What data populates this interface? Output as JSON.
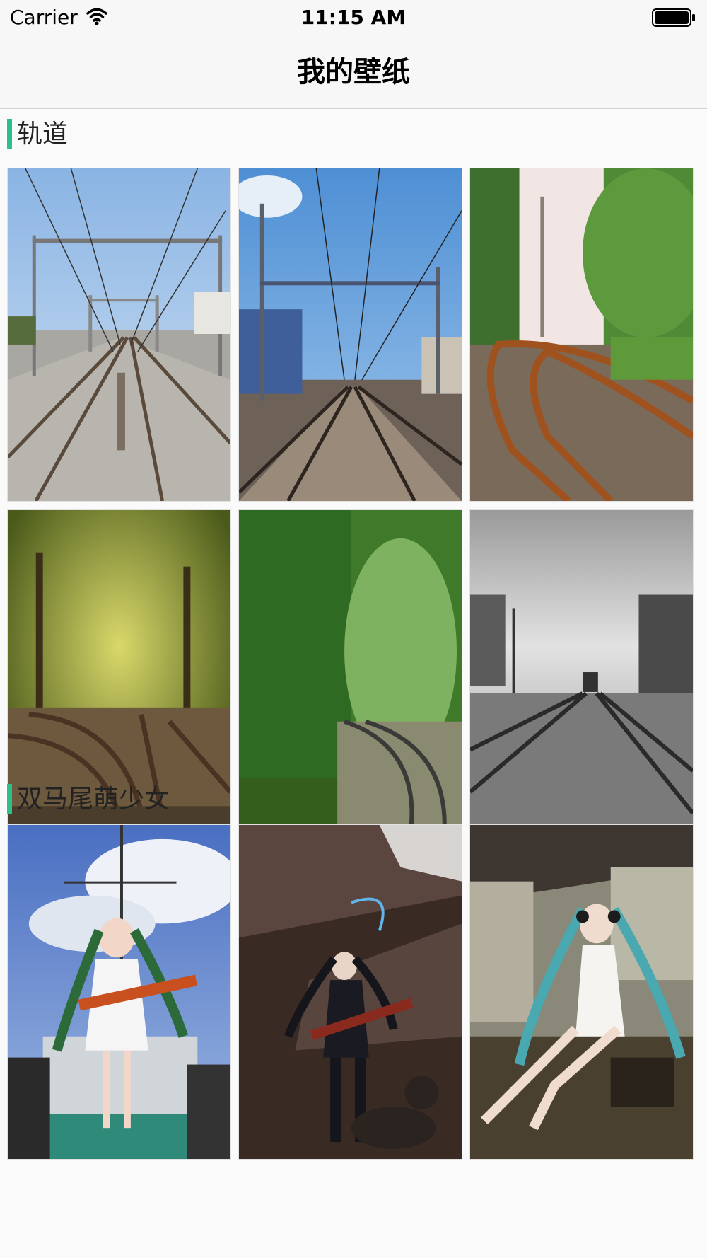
{
  "status_bar": {
    "carrier": "Carrier",
    "time": "11:15 AM",
    "icons": [
      "wifi-icon",
      "battery-icon"
    ]
  },
  "nav": {
    "title": "我的壁纸"
  },
  "sections": [
    {
      "title": "轨道",
      "accent_color": "#2fbf8a",
      "wallpapers": [
        {
          "name": "railway-overhead-wires"
        },
        {
          "name": "railway-city-blue-sky"
        },
        {
          "name": "railway-curve-rusty"
        },
        {
          "name": "railway-forest-yellow"
        },
        {
          "name": "railway-forest-green"
        },
        {
          "name": "railway-black-white-train"
        }
      ]
    },
    {
      "title": "双马尾萌少女",
      "accent_color": "#2fbf8a",
      "wallpapers": [
        {
          "name": "twin-tail-girl-guitar-clouds"
        },
        {
          "name": "twin-tail-girl-guitar-stage"
        },
        {
          "name": "twin-tail-girl-sitting-headphones"
        }
      ]
    }
  ]
}
